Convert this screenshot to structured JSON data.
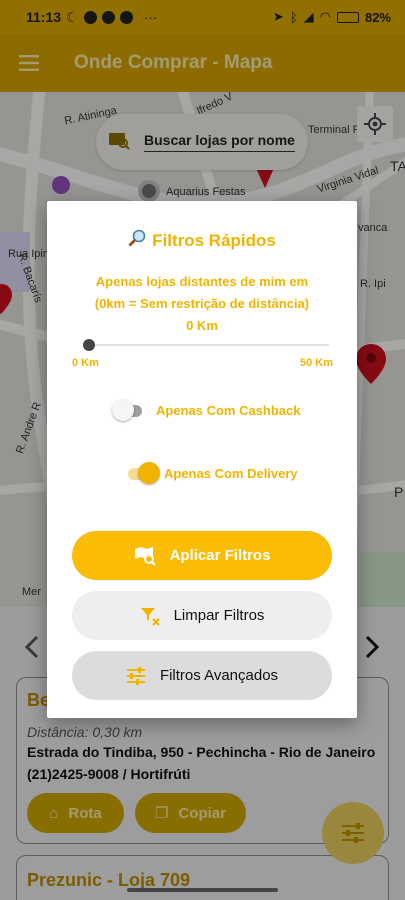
{
  "status_bar": {
    "time": "11:13",
    "battery": "82%"
  },
  "app_bar": {
    "title": "Onde Comprar - Mapa"
  },
  "map": {
    "search_placeholder": "Buscar lojas por nome",
    "labels": [
      "R. Atininga",
      "lfredo V",
      "Terminal Rodoviá",
      "Aquarius Festas",
      "Virginia Vidal",
      "Rua Ipin",
      "R. Bacarís",
      "vanca",
      "R. Andre R",
      "Mer",
      "TA",
      "P",
      "R. Ipi"
    ]
  },
  "dialog": {
    "title": "Filtros Rápidos",
    "distance_line1": "Apenas lojas distantes de mim em",
    "distance_line2": "(0km = Sem restrição de distância)",
    "distance_value": "0 Km",
    "slider_fraction": 0,
    "slider_min_label": "0 Km",
    "slider_max_label": "50 Km",
    "cashback_label": "Apenas Com Cashback",
    "cashback_on": false,
    "delivery_label": "Apenas Com Delivery",
    "delivery_on": true,
    "apply_label": "Aplicar Filtros",
    "clear_label": "Limpar Filtros",
    "advanced_label": "Filtros Avançados"
  },
  "stores": [
    {
      "name": "Be",
      "distance": "Distância: 0,30 km",
      "address": "Estrada do Tindiba, 950 - Pechincha - Rio de Janeiro",
      "phone": "(21)2425-9008 / Hortifrúti",
      "route_label": "Rota",
      "copy_label": "Copiar"
    },
    {
      "name": "Prezunic - Loja 709"
    }
  ],
  "colors": {
    "accent": "#f0b400",
    "app_bar": "#cf9f00",
    "button_primary": "#fbbc05"
  }
}
